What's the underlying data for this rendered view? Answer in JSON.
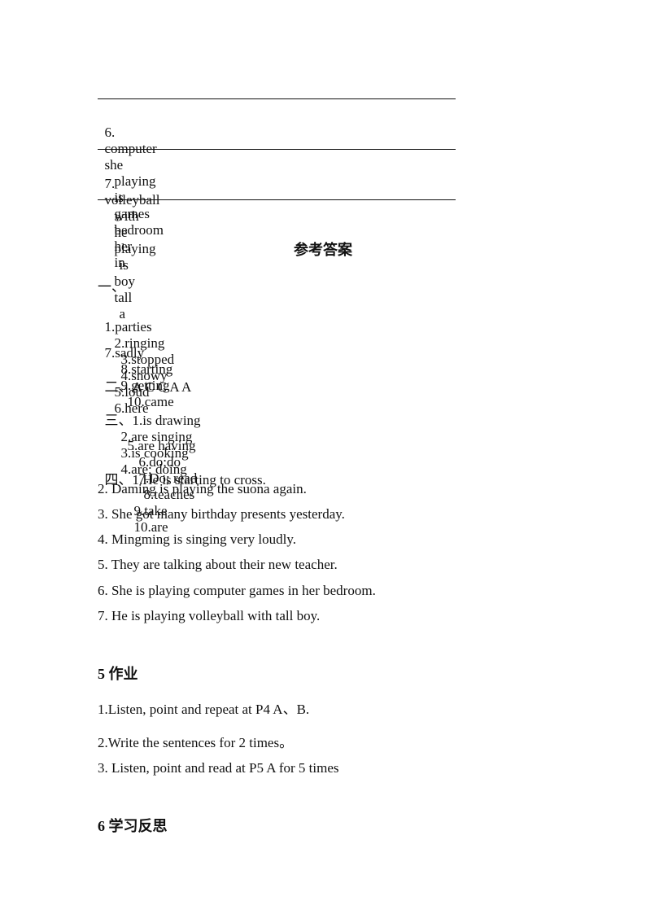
{
  "exercise": {
    "items": [
      {
        "number": "6.",
        "words": [
          "computer",
          "she",
          "playing",
          "is",
          "games",
          "bedroom",
          "her",
          "in"
        ]
      },
      {
        "number": "7.",
        "words": [
          "volleyball",
          "with",
          "he",
          "playing",
          "is",
          "boy",
          "tall",
          "a"
        ]
      }
    ]
  },
  "answer_key": {
    "title": "参考答案",
    "section1": {
      "label": "一、",
      "row1": [
        "1.parties",
        "2.ringing",
        "3.stopped",
        "4.snowy",
        "5.loud",
        "6.here"
      ],
      "row2": [
        "7.sadly",
        "8.starting",
        "9.getting",
        "10.came"
      ]
    },
    "section2": {
      "label": "二、",
      "answers": "A C C A A"
    },
    "section3": {
      "label": "三、",
      "row1": [
        "1.is drawing",
        "2.are singing",
        "3.is cooking",
        "4.are; doing"
      ],
      "row2": [
        "5.are having",
        "6.do;do",
        "7.Do; read",
        "8.teaches",
        "9.take",
        "10.are"
      ]
    },
    "section4": {
      "label": "四、",
      "sentences": [
        "1.He is starting to cross.",
        "2. Daming is playing the suona again.",
        "3. She got many birthday presents yesterday.",
        "4. Mingming is singing very loudly.",
        "5. They are talking about their new teacher.",
        "6. She is playing computer games in her bedroom.",
        "7. He is playing volleyball with tall boy."
      ]
    }
  },
  "homework": {
    "heading": "5 作业",
    "items": [
      "1.Listen, point and repeat at P4 A、B.",
      "2.Write the sentences for 2 times。",
      "3. Listen, point and read at P5 A for 5 times"
    ]
  },
  "reflection": {
    "heading": "6 学习反思"
  }
}
